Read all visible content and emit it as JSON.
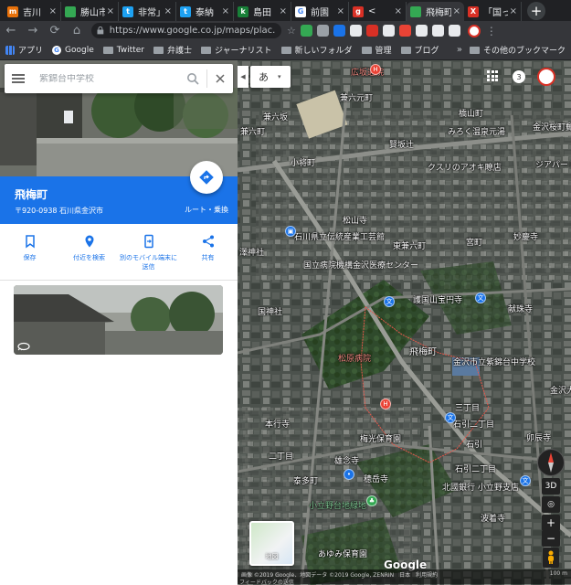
{
  "browser": {
    "tabs": [
      {
        "title": "吉川",
        "color": "#e8710a",
        "glyph": "m"
      },
      {
        "title": "勝山市",
        "color": "#34a853",
        "glyph": ""
      },
      {
        "title": "非常」",
        "color": "#1da1f2",
        "glyph": "t"
      },
      {
        "title": "泰納",
        "color": "#1da1f2",
        "glyph": "t"
      },
      {
        "title": "島田",
        "color": "#188038",
        "glyph": "k"
      },
      {
        "title": "前園",
        "color": "#ffffff",
        "glyph": "G"
      },
      {
        "title": "< ",
        "color": "#d93025",
        "glyph": "g"
      },
      {
        "title": "飛梅町",
        "color": "#34a853",
        "glyph": "",
        "active": true
      },
      {
        "title": "「国っ",
        "color": "#d93025",
        "glyph": "X"
      }
    ],
    "new_tab": "+",
    "url": "https://www.google.co.jp/maps/plac...",
    "bookmarks": [
      "アプリ",
      "Google",
      "Twitter",
      "弁護士",
      "ジャーナリスト",
      "新しいフォルダ",
      "管理",
      "ブログ"
    ],
    "bookmarks_more": "»",
    "other_bookmarks": "その他のブックマーク",
    "extension_colors": [
      "#34a853",
      "#9aa0a6",
      "#1a73e8",
      "#e8eaed",
      "#d93025",
      "#e8eaed",
      "#ea4335",
      "#e8eaed",
      "#e8eaed",
      "#e8eaed"
    ]
  },
  "panel": {
    "search_placeholder": "紫錦台中学校",
    "place_name": "飛梅町",
    "address": "〒920-0938 石川県金沢市",
    "directions_label": "ルート・乗換",
    "actions": [
      {
        "label": "保存",
        "icon": "bookmark-icon"
      },
      {
        "label": "付近を検索",
        "icon": "nearby-icon"
      },
      {
        "label": "別のモバイル端末に送信",
        "icon": "send-to-device-icon"
      },
      {
        "label": "共有",
        "icon": "share-icon"
      }
    ],
    "accent": "#1a73e8"
  },
  "map": {
    "ime": "あ",
    "notifications": "3",
    "labels": [
      {
        "t": "広坂通院",
        "c": "red",
        "l": 384,
        "tp": 72
      },
      {
        "t": "兼六元町",
        "l": 372,
        "tp": 100
      },
      {
        "t": "兼六坂",
        "l": 288,
        "tp": 121
      },
      {
        "t": "兼六町",
        "l": 263,
        "tp": 137
      },
      {
        "t": "橋山町",
        "l": 502,
        "tp": 117
      },
      {
        "t": "みろく温泉元湯",
        "l": 490,
        "tp": 137
      },
      {
        "t": "金沢桜町郵",
        "l": 583,
        "tp": 132
      },
      {
        "t": "賢坂辻",
        "l": 426,
        "tp": 151
      },
      {
        "t": "小将町",
        "l": 318,
        "tp": 171
      },
      {
        "t": "クスリのアオキ瞭店",
        "l": 468,
        "tp": 176
      },
      {
        "t": "ジアパート",
        "l": 586,
        "tp": 173
      },
      {
        "t": "松山寺",
        "l": 375,
        "tp": 234
      },
      {
        "t": "妙慶寺",
        "l": 562,
        "tp": 252
      },
      {
        "t": "石川県立伝統産業工芸館",
        "l": 322,
        "tp": 252
      },
      {
        "t": "東兼六町",
        "l": 430,
        "tp": 262
      },
      {
        "t": "宮町",
        "l": 510,
        "tp": 258
      },
      {
        "t": "澤神社",
        "l": 262,
        "tp": 269
      },
      {
        "t": "国立病院機構金沢医療センター",
        "l": 332,
        "tp": 283
      },
      {
        "t": "護国山宝円寺",
        "l": 452,
        "tp": 321
      },
      {
        "t": "献珠寺",
        "l": 556,
        "tp": 331
      },
      {
        "t": "国神社",
        "l": 282,
        "tp": 334
      },
      {
        "t": "松原病院",
        "c": "red",
        "l": 370,
        "tp": 385
      },
      {
        "t": "飛梅町",
        "c": "big",
        "l": 448,
        "tp": 376
      },
      {
        "t": "金沢市立紫錦台中学校",
        "l": 496,
        "tp": 389
      },
      {
        "t": "金沢大",
        "l": 602,
        "tp": 420
      },
      {
        "t": "三丁目",
        "l": 498,
        "tp": 439
      },
      {
        "t": "本行寺",
        "l": 290,
        "tp": 457
      },
      {
        "t": "梅光保育園",
        "l": 394,
        "tp": 473
      },
      {
        "t": "石引二丁目",
        "l": 496,
        "tp": 457
      },
      {
        "t": "石引",
        "l": 510,
        "tp": 479
      },
      {
        "t": "卯辰寺",
        "l": 576,
        "tp": 472
      },
      {
        "t": "二丁目",
        "l": 294,
        "tp": 492
      },
      {
        "t": "雄念寺",
        "l": 366,
        "tp": 497
      },
      {
        "t": "石引二丁目",
        "l": 498,
        "tp": 506
      },
      {
        "t": "泰多町",
        "l": 321,
        "tp": 519
      },
      {
        "t": "穂岳寺",
        "l": 398,
        "tp": 517
      },
      {
        "t": "北國銀行 小立野支店",
        "l": 484,
        "tp": 526
      },
      {
        "t": "小立野台地緑地",
        "c": "green",
        "l": 338,
        "tp": 546
      },
      {
        "t": "波着寺",
        "l": 526,
        "tp": 560
      },
      {
        "t": "あゆみ保育園",
        "l": 348,
        "tp": 599
      }
    ],
    "thumb_label": "地図",
    "google_logo": "Google",
    "footer_text": "画像 ©2019 Google、地図データ ©2019 Google, ZENRIN　日本　利用規約",
    "footer_scale": "100 m",
    "feedback": "フィードバックの送信",
    "ctrl_3d": "3D",
    "ctrl_plus": "+",
    "ctrl_minus": "−"
  }
}
